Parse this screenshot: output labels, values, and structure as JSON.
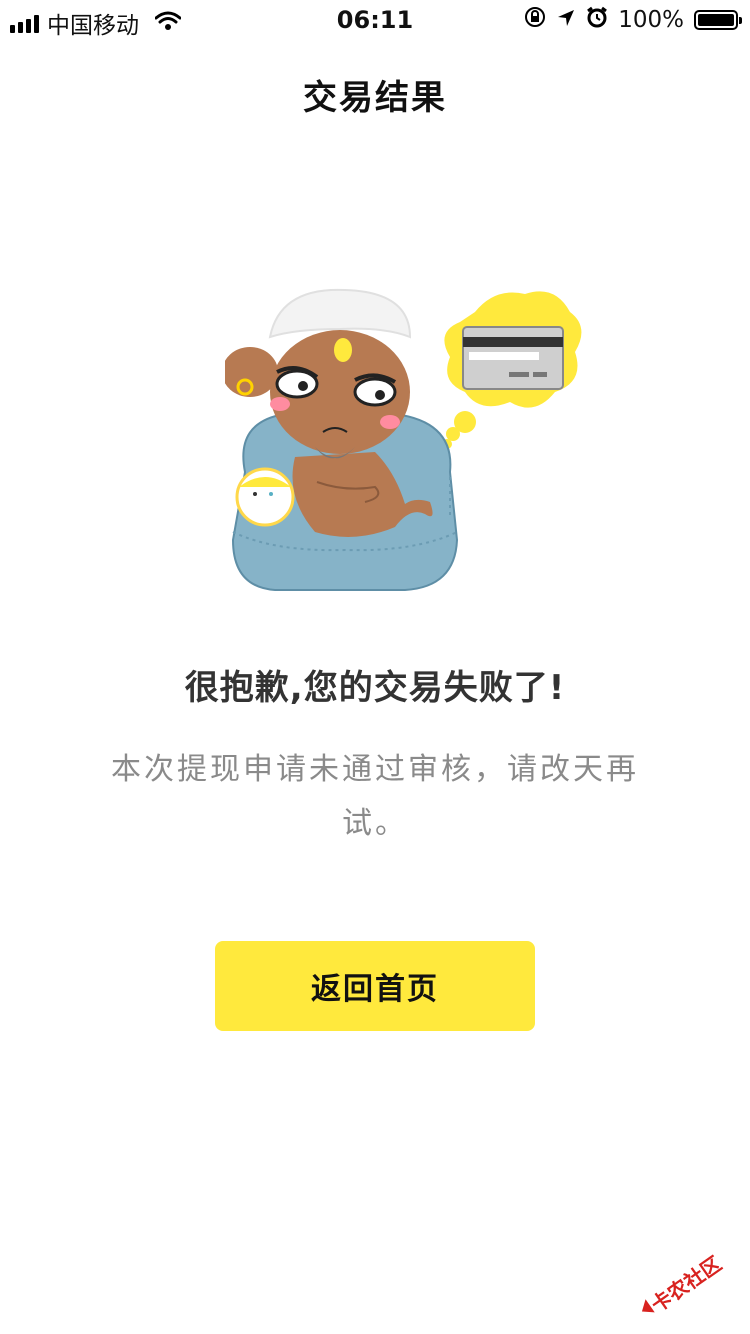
{
  "status_bar": {
    "carrier": "中国移动",
    "time": "06:11",
    "battery_percent": "100%",
    "battery_level": 1.0
  },
  "nav": {
    "title": "交易结果"
  },
  "result": {
    "title": "很抱歉,您的交易失败了!",
    "description": "本次提现申请未通过审核，请改天再试。"
  },
  "actions": {
    "home_button_label": "返回首页"
  },
  "watermark": {
    "text": "卡农社区"
  },
  "colors": {
    "accent_yellow": "#ffe93d",
    "sofa_blue": "#86b3c8",
    "skin": "#b77a52"
  },
  "icons": [
    "signal-icon",
    "wifi-icon",
    "rotation-lock-icon",
    "location-arrow-icon",
    "alarm-icon",
    "battery-icon"
  ]
}
